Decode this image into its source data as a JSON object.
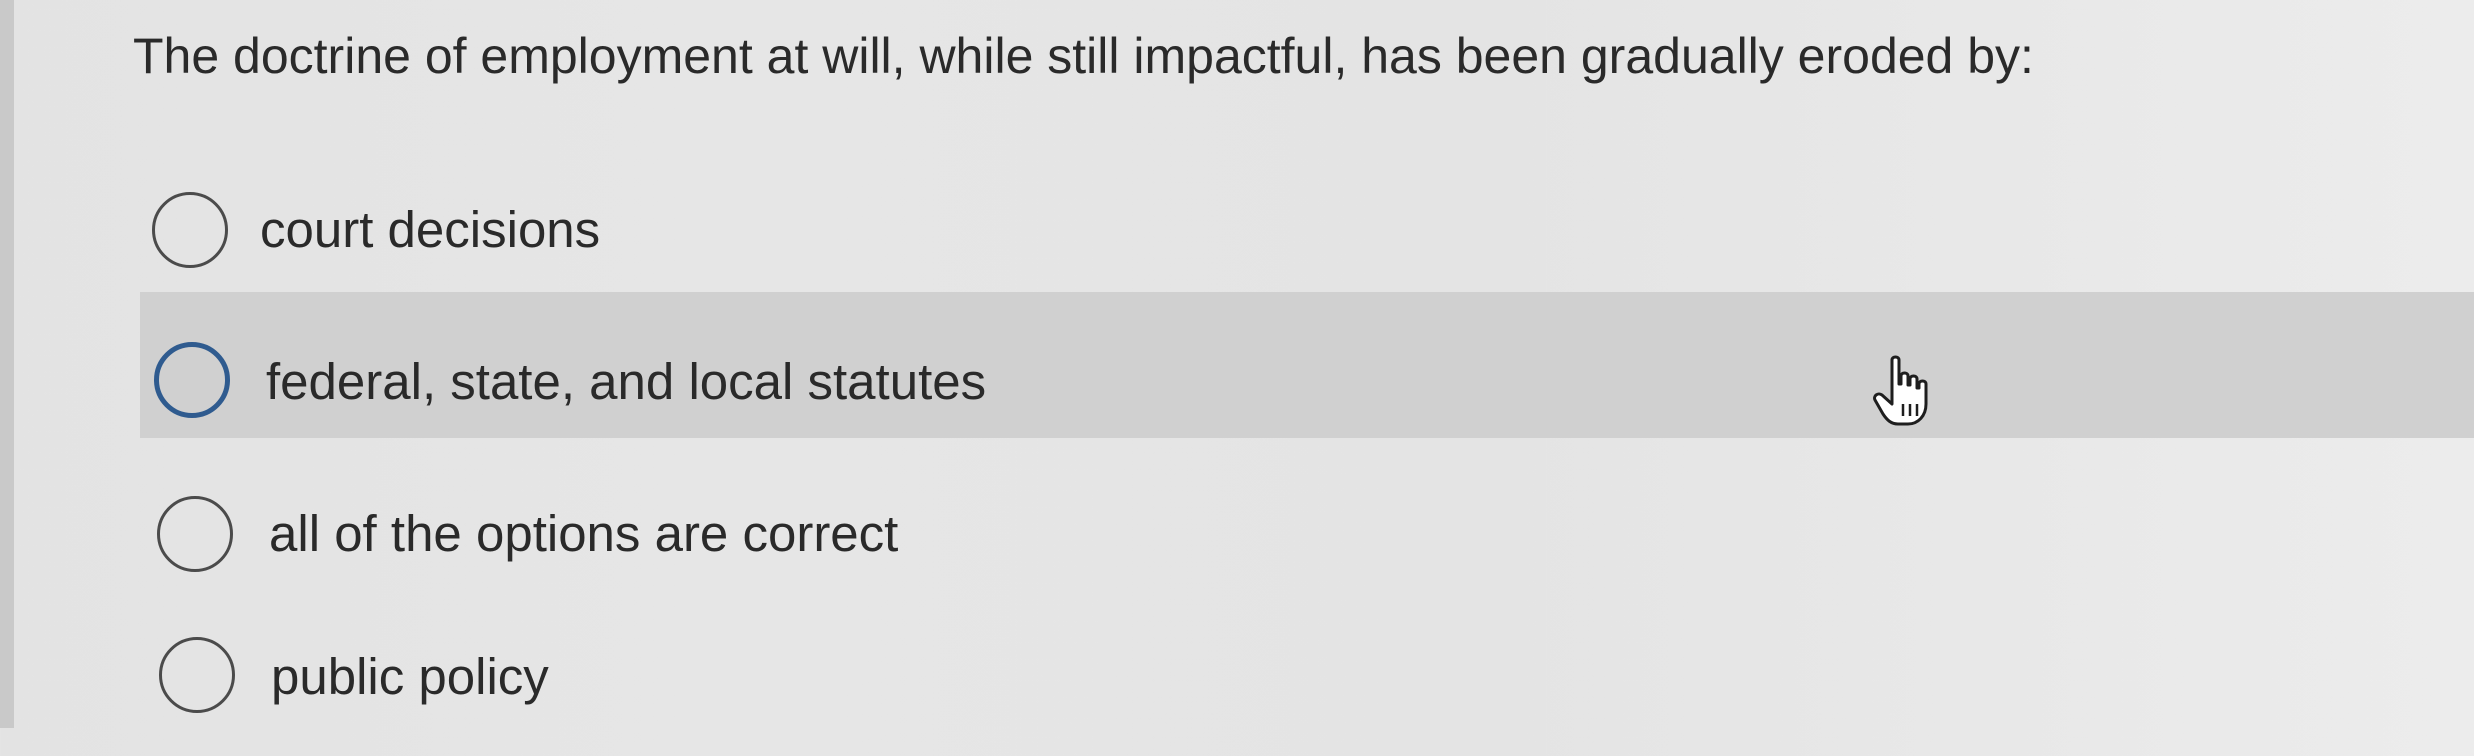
{
  "question": {
    "text": "The doctrine of employment at will, while still impactful, has been gradually eroded by:"
  },
  "options": [
    {
      "label": "court decisions",
      "selected": false,
      "hovered": false
    },
    {
      "label": "federal, state, and local statutes",
      "selected": false,
      "hovered": true
    },
    {
      "label": "all of the options are correct",
      "selected": false,
      "hovered": false
    },
    {
      "label": "public policy",
      "selected": false,
      "hovered": false
    }
  ],
  "colors": {
    "background": "#e5e5e5",
    "hover_row": "#d0d0d0",
    "hover_radio": "#2f5b8f",
    "text": "#2a2a2a"
  },
  "cursor": {
    "icon": "hand-pointer-icon"
  }
}
